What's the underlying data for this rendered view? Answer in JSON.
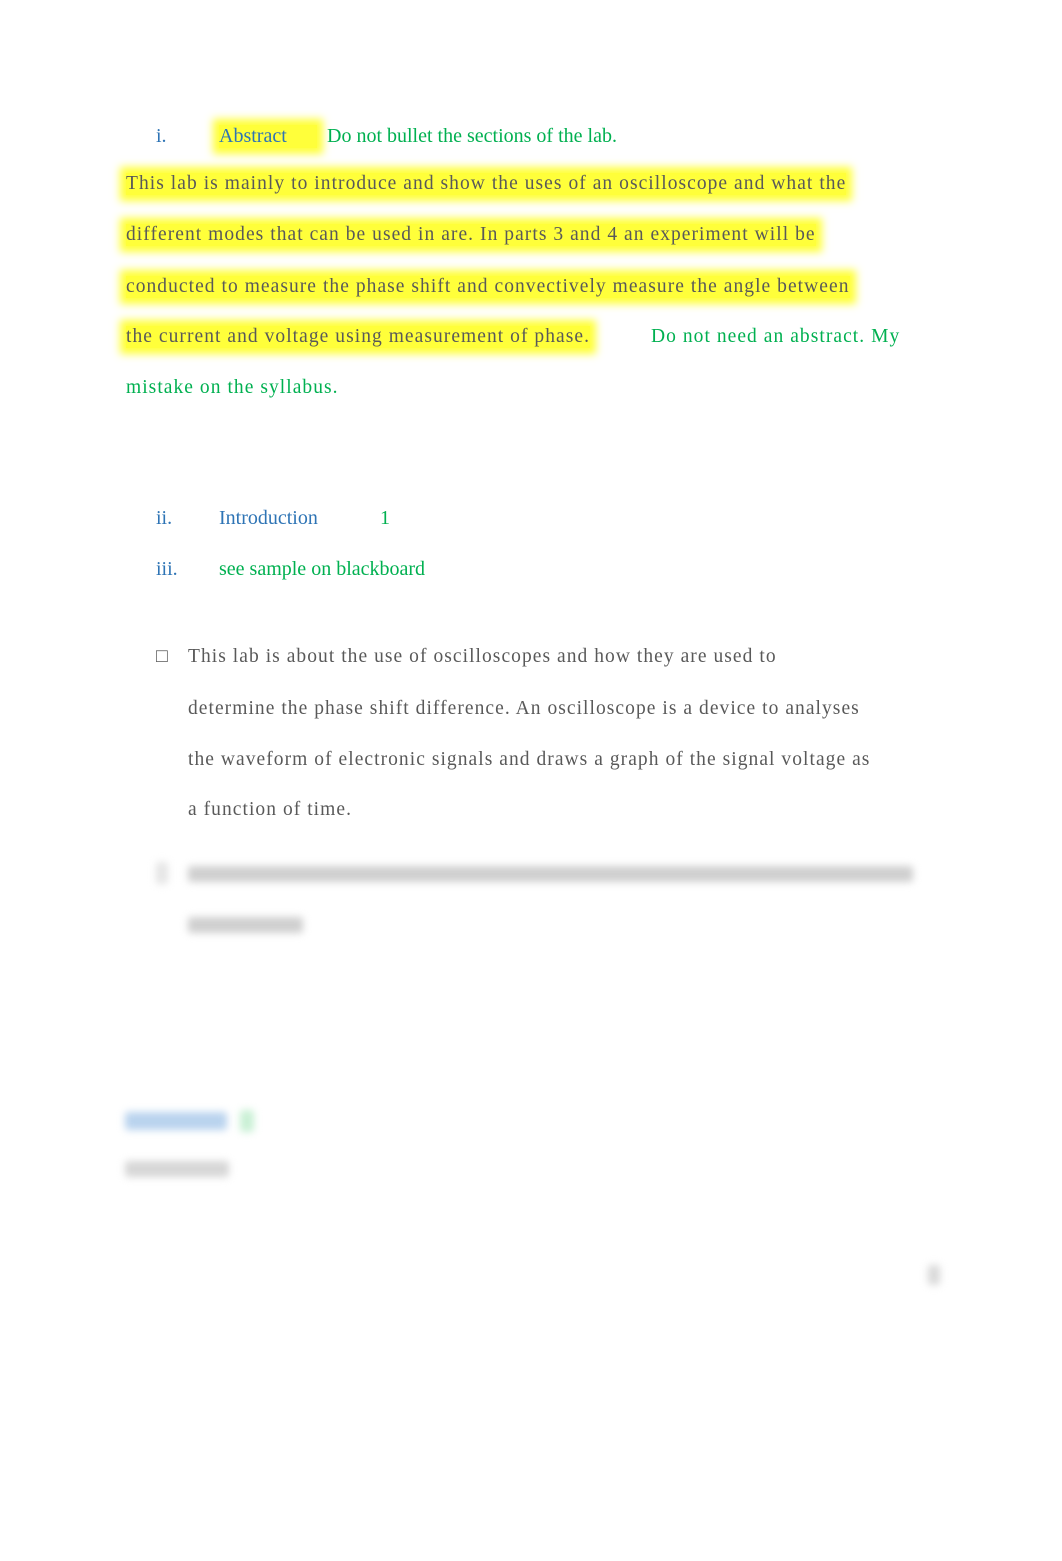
{
  "sections": [
    {
      "numeral": "i.",
      "title": "Abstract",
      "comment": "Do not bullet the sections of the lab."
    },
    {
      "numeral": "ii.",
      "title": "Introduction",
      "comment": "1"
    },
    {
      "numeral": "iii.",
      "title": "",
      "comment": "see sample on blackboard"
    }
  ],
  "abstract": {
    "lines": [
      "This lab is mainly to introduce and show the uses of an oscilloscope and what the",
      "different modes that can be used in are. In parts 3 and 4 an experiment will be",
      "conducted to measure the phase shift and convectively measure the angle between",
      "the current and voltage using measurement of phase."
    ],
    "comment_line1": "Do not need an abstract. My",
    "comment_line2": "mistake on the syllabus."
  },
  "intro_bullet": {
    "bullet": "",
    "lines": [
      "This lab is about the use of oscilloscopes and how they are used to",
      "determine the phase shift difference. An oscilloscope is a device to analyses",
      "the waveform of electronic signals and draws a graph of the signal voltage as",
      "a function of time."
    ]
  },
  "colors": {
    "heading": "#2e74b5",
    "comment": "#00b050",
    "highlight": "#ffff3a",
    "body": "#595959"
  }
}
